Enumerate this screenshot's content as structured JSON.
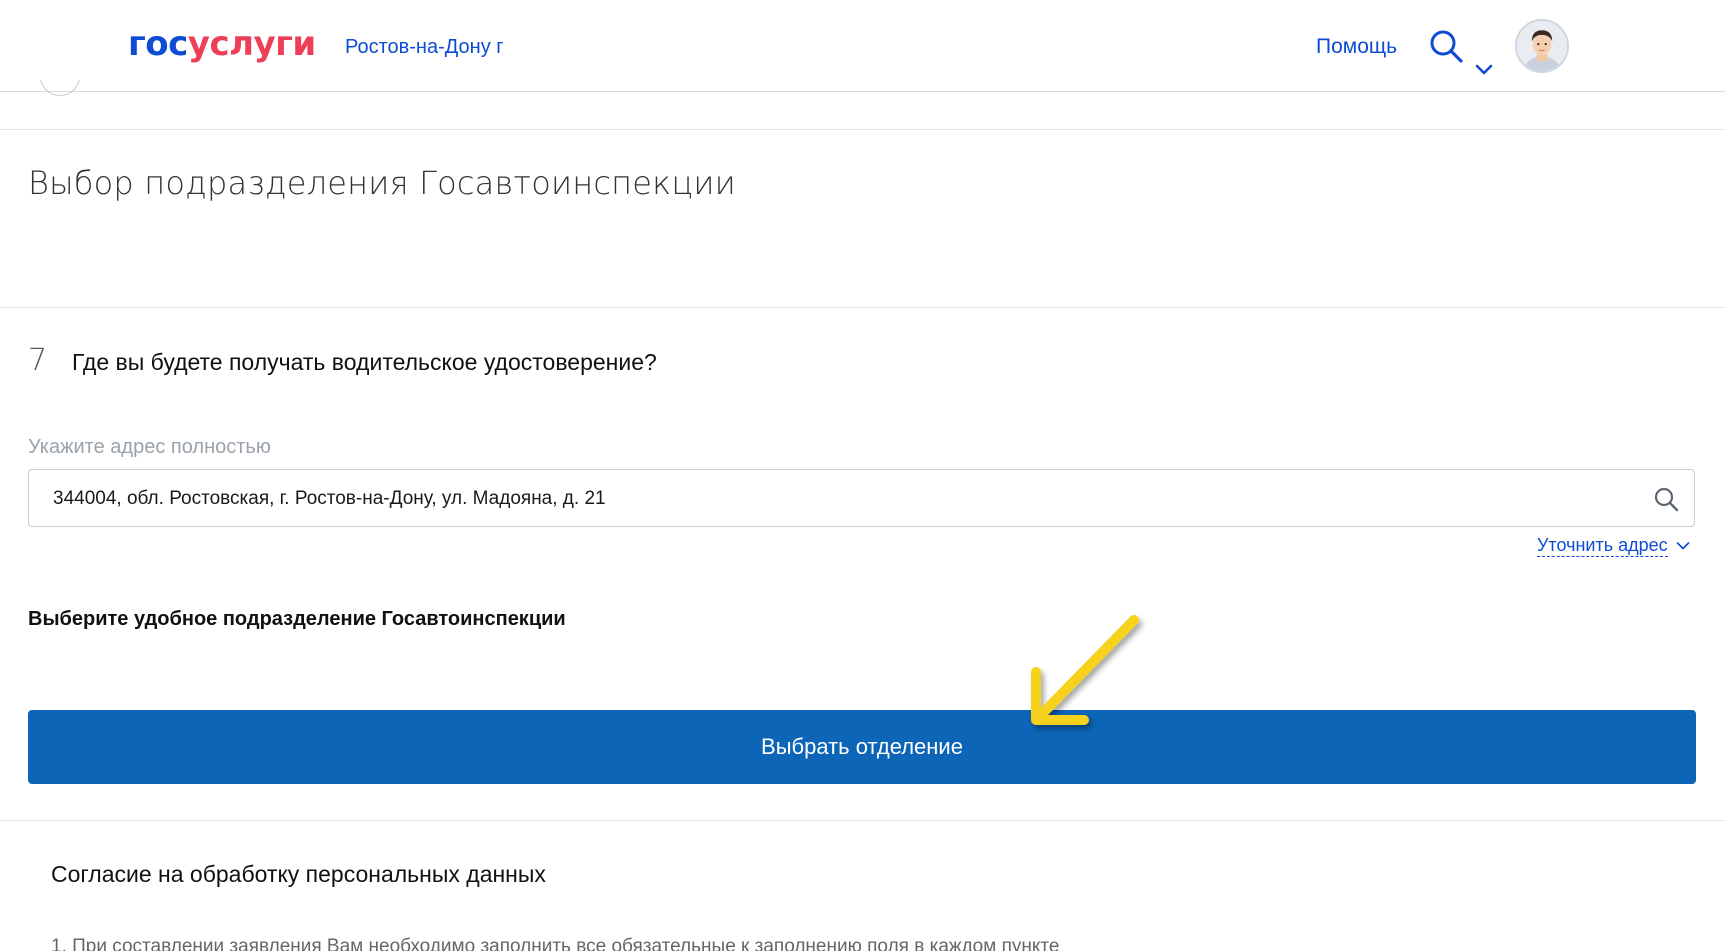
{
  "header": {
    "logo_part1": "гос",
    "logo_part2": "услуги",
    "city": "Ростов-на-Дону г",
    "help": "Помощь",
    "icons": {
      "search": "search-icon",
      "dropdown": "chevron-down-icon",
      "avatar": "user-avatar"
    }
  },
  "section": {
    "title": "Выбор подразделения Госавтоинспекции"
  },
  "step": {
    "number": "7",
    "question": "Где вы будете получать водительское удостоверение?",
    "address_label": "Укажите адрес полностью",
    "address_value": "344004, обл. Ростовская, г. Ростов-на-Дону, ул. Мадояна, д. 21",
    "refine_link": "Уточнить адрес",
    "subhead": "Выберите удобное подразделение Госавтоинспекции",
    "choose_button": "Выбрать отделение"
  },
  "consent": {
    "title": "Согласие на обработку персональных данных",
    "first_item": "1. При составлении заявления Вам необходимо заполнить все обязательные к заполнению поля в каждом пункте"
  },
  "colors": {
    "brand_blue": "#0d4cd3",
    "brand_red": "#ee3f58",
    "button_blue": "#0c65b6",
    "annotation_arrow": "#f7d21a"
  }
}
